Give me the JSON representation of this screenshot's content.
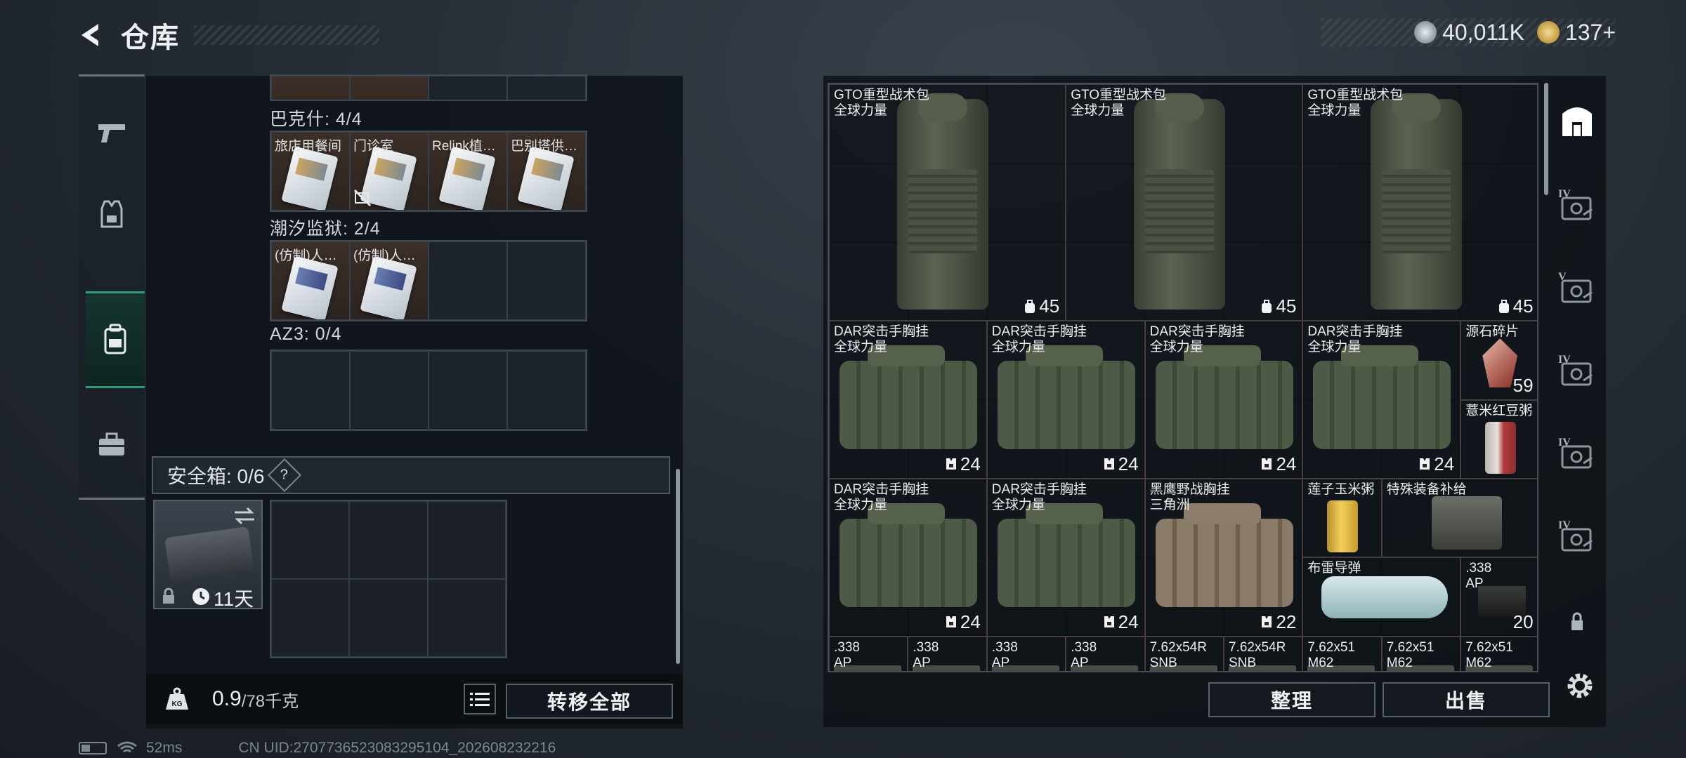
{
  "header": {
    "title": "仓库"
  },
  "currency": [
    {
      "icon": "silver-coin-icon",
      "value": "40,011K",
      "color": "#b8bec4"
    },
    {
      "icon": "gold-coin-icon",
      "value": "137+",
      "color": "#c9a44a"
    }
  ],
  "left_nav": [
    {
      "icon": "pistol-icon"
    },
    {
      "icon": "armor-vest-icon"
    },
    {
      "icon": "backpack-icon",
      "active": true
    },
    {
      "icon": "toolbox-icon"
    }
  ],
  "keycard_groups": [
    {
      "label": "巴克什: 4/4",
      "slots": [
        {
          "name": "旅店用餐间",
          "filled": true,
          "img": "gold"
        },
        {
          "name": "门诊室",
          "filled": true,
          "img": "gold",
          "no_trade": true
        },
        {
          "name": "Relink植…",
          "filled": true,
          "img": "gold"
        },
        {
          "name": "巴别塔供…",
          "filled": true,
          "img": "gold"
        }
      ]
    },
    {
      "label": "潮汐监狱: 2/4",
      "slots": [
        {
          "name": "(仿制)人…",
          "filled": true,
          "img": "blue"
        },
        {
          "name": "(仿制)人…",
          "filled": true,
          "img": "blue"
        },
        {
          "name": "",
          "filled": false
        },
        {
          "name": "",
          "filled": false
        }
      ]
    },
    {
      "label": "AZ3: 0/4",
      "slots": [
        {
          "name": "",
          "filled": false
        },
        {
          "name": "",
          "filled": false
        },
        {
          "name": "",
          "filled": false
        },
        {
          "name": "",
          "filled": false
        }
      ]
    }
  ],
  "safebox": {
    "label": "安全箱: 0/6",
    "help": "?",
    "timer": "11天"
  },
  "footer": {
    "weight": "0.9",
    "weight_unit": "/78千克",
    "transfer_all": "转移全部"
  },
  "stash_items": [
    {
      "name": "GTO重型战术包",
      "sub": "全球力量",
      "qty": "45",
      "kind": "backpack",
      "bg": "red"
    },
    {
      "name": "GTO重型战术包",
      "sub": "全球力量",
      "qty": "45",
      "kind": "backpack",
      "bg": "red"
    },
    {
      "name": "GTO重型战术包",
      "sub": "全球力量",
      "qty": "45",
      "kind": "backpack",
      "bg": "red"
    },
    {
      "name": "DAR突击手胸挂",
      "sub": "全球力量",
      "qty": "24",
      "kind": "rig",
      "bg": "brown"
    },
    {
      "name": "DAR突击手胸挂",
      "sub": "全球力量",
      "qty": "24",
      "kind": "rig",
      "bg": "brown"
    },
    {
      "name": "DAR突击手胸挂",
      "sub": "全球力量",
      "qty": "24",
      "kind": "rig",
      "bg": "brown"
    },
    {
      "name": "DAR突击手胸挂",
      "sub": "全球力量",
      "qty": "24",
      "kind": "rig",
      "bg": "brown"
    },
    {
      "name": "源石碎片",
      "sub": "",
      "qty": "59",
      "kind": "crystal",
      "bg": "navy"
    },
    {
      "name": "薏米红豆粥",
      "sub": "",
      "qty": "",
      "kind": "can-red",
      "bg": "brown"
    },
    {
      "name": "DAR突击手胸挂",
      "sub": "全球力量",
      "qty": "24",
      "kind": "rig",
      "bg": "brown"
    },
    {
      "name": "DAR突击手胸挂",
      "sub": "全球力量",
      "qty": "24",
      "kind": "rig",
      "bg": "brown"
    },
    {
      "name": "黑鹰野战胸挂",
      "sub": "三角洲",
      "qty": "22",
      "kind": "rig-tan",
      "bg": "brown"
    },
    {
      "name": "莲子玉米粥",
      "sub": "",
      "qty": "",
      "kind": "can-yellow",
      "bg": "green"
    },
    {
      "name": "特殊装备补给",
      "sub": "",
      "qty": "",
      "kind": "case",
      "bg": "navy"
    },
    {
      "name": "布雷导弹",
      "sub": "",
      "qty": "",
      "kind": "missile",
      "bg": "navy"
    },
    {
      "name": ".338",
      "sub": "AP",
      "qty": "20",
      "kind": "ammo-box",
      "bg": "red"
    },
    {
      "name": ".338",
      "sub": "AP",
      "qty": "",
      "kind": "ammo",
      "bg": "red"
    },
    {
      "name": ".338",
      "sub": "AP",
      "qty": "",
      "kind": "ammo",
      "bg": "red"
    },
    {
      "name": ".338",
      "sub": "AP",
      "qty": "",
      "kind": "ammo",
      "bg": "red"
    },
    {
      "name": ".338",
      "sub": "AP",
      "qty": "",
      "kind": "ammo",
      "bg": "red"
    },
    {
      "name": "7.62x54R",
      "sub": "SNB",
      "qty": "",
      "kind": "ammo",
      "bg": "red"
    },
    {
      "name": "7.62x54R",
      "sub": "SNB",
      "qty": "",
      "kind": "ammo",
      "bg": "red"
    },
    {
      "name": "7.62x51",
      "sub": "M62",
      "qty": "",
      "kind": "ammo",
      "bg": "red"
    },
    {
      "name": "7.62x51",
      "sub": "M62",
      "qty": "",
      "kind": "ammo",
      "bg": "red"
    },
    {
      "name": "7.62x51",
      "sub": "M62",
      "qty": "",
      "kind": "ammo",
      "bg": "red"
    }
  ],
  "right_actions": {
    "sort": "整理",
    "sell": "出售"
  },
  "right_nav": [
    {
      "icon": "stash-home-icon",
      "active": true
    },
    {
      "icon": "tier-iv-case-icon",
      "label": "IV"
    },
    {
      "icon": "tier-v-case-icon",
      "label": "V"
    },
    {
      "icon": "tier-iv-case-icon",
      "label": "IV"
    },
    {
      "icon": "tier-iv-case-icon",
      "label": "IV"
    },
    {
      "icon": "tier-iv-case-icon",
      "label": "IV"
    },
    {
      "icon": "lock-icon"
    }
  ],
  "status": {
    "ping": "52ms",
    "uid": "CN UID:2707736523083295104_202608232216"
  }
}
